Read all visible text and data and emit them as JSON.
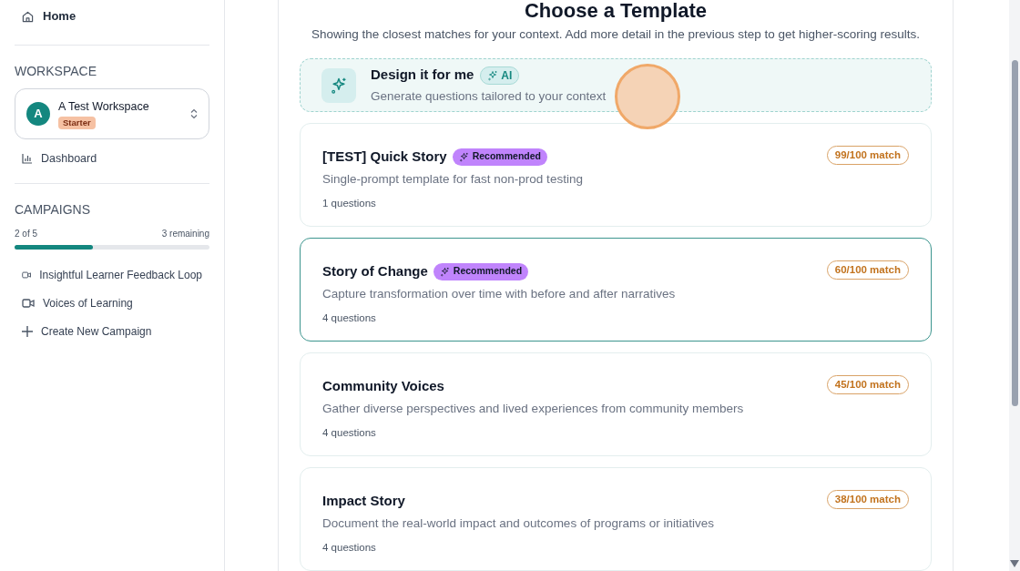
{
  "sidebar": {
    "home": "Home",
    "workspace_heading": "WORKSPACE",
    "workspace": {
      "avatar": "A",
      "name": "A Test Workspace",
      "plan": "Starter"
    },
    "dashboard": "Dashboard",
    "campaigns_heading": "CAMPAIGNS",
    "usage": {
      "count": "2 of 5",
      "remaining": "3 remaining",
      "level": 0.4
    },
    "campaigns": [
      {
        "kind": "campaign",
        "label": "Insightful Learner Feedback Loop"
      },
      {
        "kind": "campaign",
        "label": "Voices of Learning"
      },
      {
        "kind": "create",
        "label": "Create New Campaign"
      }
    ]
  },
  "main": {
    "title": "Choose a Template",
    "subtitle": "Showing the closest matches for your context. Add more detail in the previous step to get higher-scoring results.",
    "design_card": {
      "title": "Design it for me",
      "badge": "AI",
      "description": "Generate questions tailored to your context"
    },
    "templates": [
      {
        "title": "[TEST] Quick Story",
        "recommended": true,
        "recommended_label": "Recommended",
        "description": "Single-prompt template for fast non-prod testing",
        "questions": "1 questions",
        "match": "99/100 match",
        "selected": false
      },
      {
        "title": "Story of Change",
        "recommended": true,
        "recommended_label": "Recommended",
        "description": "Capture transformation over time with before and after narratives",
        "questions": "4 questions",
        "match": "60/100 match",
        "selected": true
      },
      {
        "title": "Community Voices",
        "recommended": false,
        "description": "Gather diverse perspectives and lived experiences from community members",
        "questions": "4 questions",
        "match": "45/100 match",
        "selected": false
      },
      {
        "title": "Impact Story",
        "recommended": false,
        "description": "Document the real-world impact and outcomes of programs or initiatives",
        "questions": "4 questions",
        "match": "38/100 match",
        "selected": false
      }
    ]
  }
}
